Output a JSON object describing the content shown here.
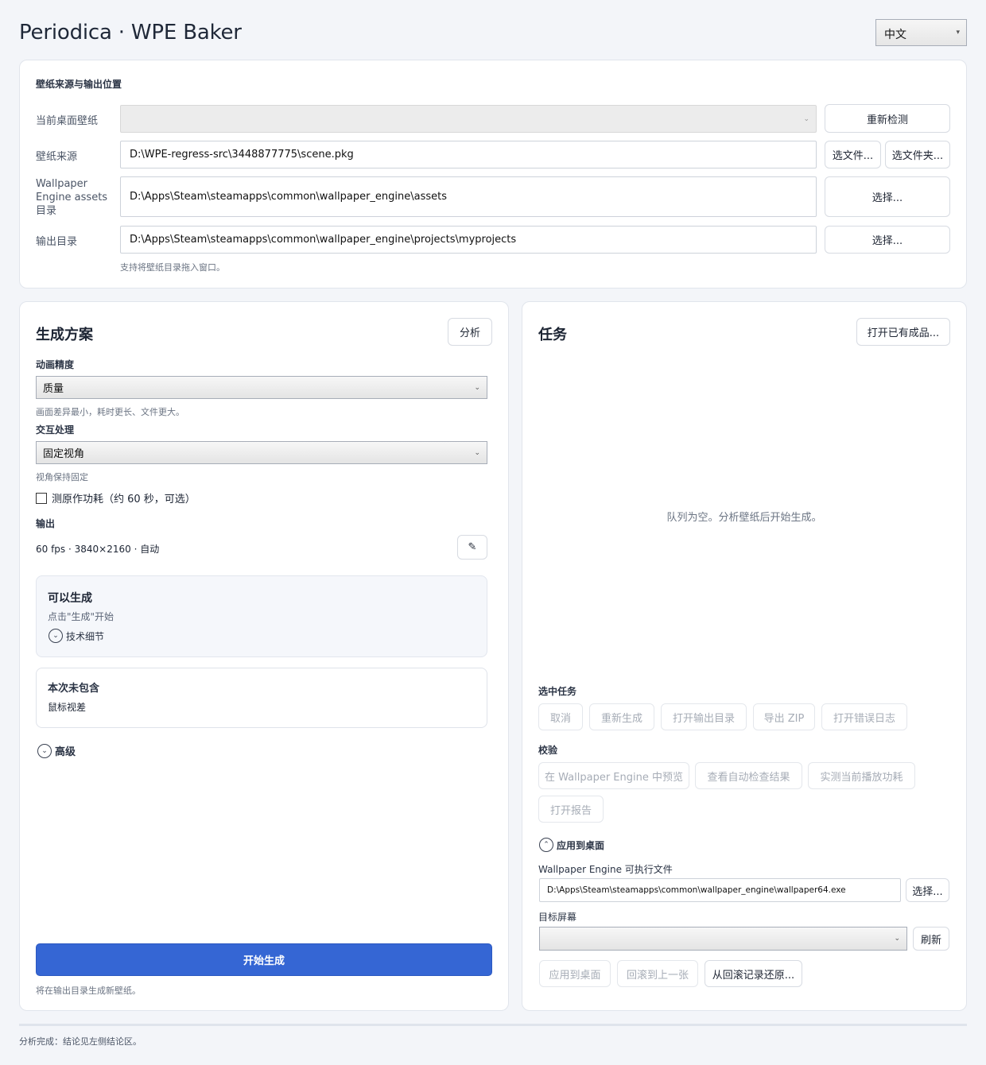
{
  "app": {
    "title": "Periodica · WPE Baker",
    "language": "中文"
  },
  "source_section": {
    "title": "壁纸来源与输出位置",
    "current_wallpaper": {
      "label": "当前桌面壁纸",
      "value": "",
      "button": "重新检测"
    },
    "source": {
      "label": "壁纸来源",
      "value": "D:\\WPE-regress-src\\3448877775\\scene.pkg",
      "file_button": "选文件...",
      "folder_button": "选文件夹..."
    },
    "assets": {
      "label": "Wallpaper Engine assets 目录",
      "value": "D:\\Apps\\Steam\\steamapps\\common\\wallpaper_engine\\assets",
      "button": "选择..."
    },
    "output": {
      "label": "输出目录",
      "value": "D:\\Apps\\Steam\\steamapps\\common\\wallpaper_engine\\projects\\myprojects",
      "button": "选择..."
    },
    "hint": "支持将壁纸目录拖入窗口。"
  },
  "plan": {
    "title": "生成方案",
    "analyze_button": "分析",
    "precision": {
      "label": "动画精度",
      "value": "质量",
      "hint": "画面差异最小，耗时更长、文件更大。"
    },
    "interaction": {
      "label": "交互处理",
      "value": "固定视角",
      "hint": "视角保持固定"
    },
    "power_checkbox": {
      "label": "测原作功耗（约 60 秒，可选）",
      "checked": false
    },
    "output": {
      "label": "输出",
      "value": "60 fps · 3840×2160 · 自动"
    },
    "status": {
      "title": "可以生成",
      "subtitle": "点击\"生成\"开始",
      "details_toggle": "技术细节"
    },
    "excluded": {
      "title": "本次未包含",
      "item": "鼠标视差"
    },
    "advanced": "高级",
    "start_button": "开始生成",
    "start_hint": "将在输出目录生成新壁纸。"
  },
  "tasks": {
    "title": "任务",
    "open_button": "打开已有成品...",
    "empty_text": "队列为空。分析壁纸后开始生成。",
    "selected": {
      "label": "选中任务",
      "buttons": [
        "取消",
        "重新生成",
        "打开输出目录",
        "导出 ZIP",
        "打开错误日志"
      ]
    },
    "verify": {
      "label": "校验",
      "buttons": [
        "在 Wallpaper Engine 中预览",
        "查看自动检查结果",
        "实测当前播放功耗",
        "打开报告"
      ]
    },
    "apply": {
      "toggle": "应用到桌面",
      "exe_label": "Wallpaper Engine 可执行文件",
      "exe_value": "D:\\Apps\\Steam\\steamapps\\common\\wallpaper_engine\\wallpaper64.exe",
      "exe_button": "选择...",
      "screen_label": "目标屏幕",
      "screen_value": "",
      "refresh_button": "刷新",
      "buttons": [
        "应用到桌面",
        "回滚到上一张",
        "从回滚记录还原..."
      ]
    }
  },
  "status_bar": "分析完成：结论见左侧结论区。",
  "colors": {
    "primary": "#3566d4",
    "background": "#f3f5f9"
  }
}
